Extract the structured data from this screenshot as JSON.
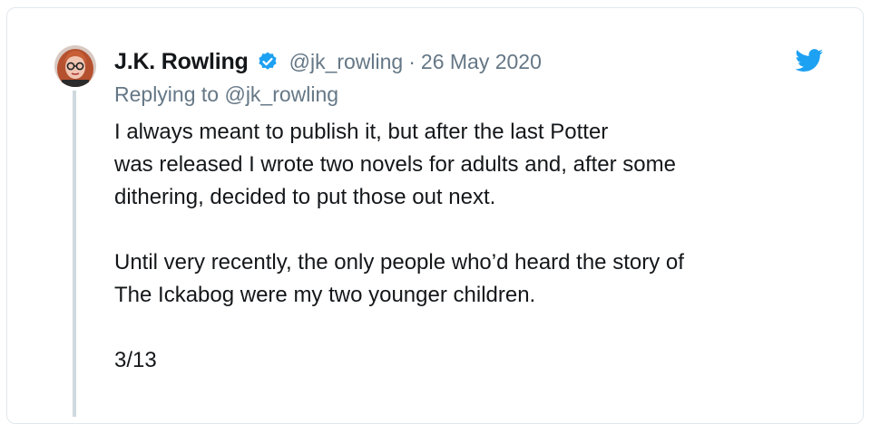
{
  "tweet": {
    "author_name": "J.K. Rowling",
    "verified_icon": "verified-badge-icon",
    "handle": "@jk_rowling",
    "separator": "·",
    "date": "26 May 2020",
    "replying_prefix": "Replying to",
    "replying_to": "@jk_rowling",
    "paragraphs": [
      "I always meant to publish it, but after the last Potter\nwas released I wrote two novels for adults and, after some\ndithering, decided to put those out next.",
      "Until very recently, the only people who’d heard the story of\nThe Ickabog were my two younger children.",
      "3/13"
    ],
    "avatar_icon": "avatar-photo",
    "platform_icon": "twitter-bird-icon"
  },
  "colors": {
    "accent": "#1da1f2",
    "text": "#14171a",
    "muted": "#657786",
    "border": "#e1e8ed",
    "thread_line": "#cfd9de"
  }
}
